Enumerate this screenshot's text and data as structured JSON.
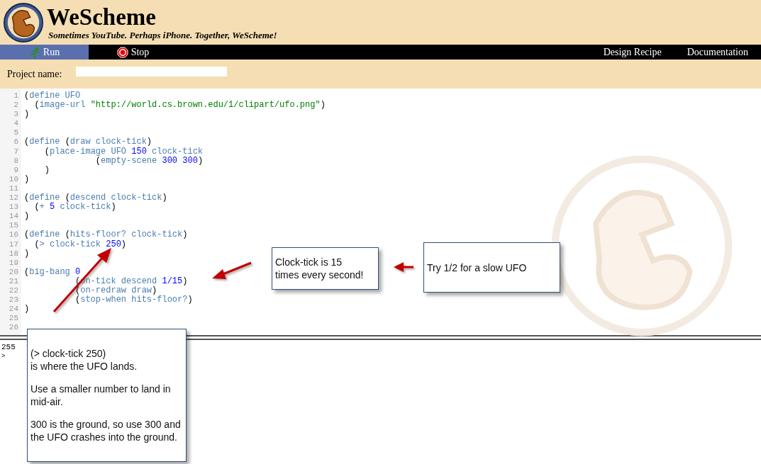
{
  "header": {
    "title": "WeScheme",
    "tagline": "Sometimes YouTube. Perhaps iPhone. Together, WeScheme!"
  },
  "toolbar": {
    "left": [
      {
        "label": "Run",
        "kind": "run",
        "selected": true
      },
      {
        "label": "Stop",
        "kind": "stop",
        "selected": false
      }
    ],
    "right": [
      "Design Recipe",
      "Documentation"
    ]
  },
  "project": {
    "label": "Project name:"
  },
  "editor": {
    "lines": [
      {
        "number": "1",
        "tokens": [
          {
            "kind": "paren",
            "text": "("
          },
          {
            "kind": "keyword",
            "text": "define UFO"
          }
        ]
      },
      {
        "number": "2",
        "tokens": [
          {
            "kind": "paren",
            "text": "  ("
          },
          {
            "kind": "keyword",
            "text": "image-url "
          },
          {
            "kind": "string",
            "text": "\"http://world.cs.brown.edu/1/clipart/ufo.png\""
          },
          {
            "kind": "paren",
            "text": ")"
          }
        ]
      },
      {
        "number": "3",
        "tokens": [
          {
            "kind": "paren",
            "text": ")"
          }
        ]
      },
      {
        "number": "4"
      },
      {
        "number": "5"
      },
      {
        "number": "6",
        "tokens": [
          {
            "kind": "paren",
            "text": "("
          },
          {
            "kind": "keyword",
            "text": "define "
          },
          {
            "kind": "paren",
            "text": "("
          },
          {
            "kind": "keyword",
            "text": "draw clock-tick"
          },
          {
            "kind": "paren",
            "text": ")"
          }
        ]
      },
      {
        "number": "7",
        "tokens": [
          {
            "kind": "paren",
            "text": "    ("
          },
          {
            "kind": "keyword",
            "text": "place-image UFO "
          },
          {
            "kind": "number",
            "text": "150"
          },
          {
            "kind": "keyword",
            "text": " clock-tick"
          }
        ]
      },
      {
        "number": "8",
        "tokens": [
          {
            "kind": "paren",
            "text": "              ("
          },
          {
            "kind": "keyword",
            "text": "empty-scene "
          },
          {
            "kind": "number",
            "text": "300 300"
          },
          {
            "kind": "paren",
            "text": ")"
          }
        ]
      },
      {
        "number": "9",
        "tokens": [
          {
            "kind": "paren",
            "text": "    )"
          }
        ]
      },
      {
        "number": "10",
        "tokens": [
          {
            "kind": "paren",
            "text": ")"
          }
        ]
      },
      {
        "number": "11"
      },
      {
        "number": "12",
        "tokens": [
          {
            "kind": "paren",
            "text": "("
          },
          {
            "kind": "keyword",
            "text": "define "
          },
          {
            "kind": "paren",
            "text": "("
          },
          {
            "kind": "keyword",
            "text": "descend clock-tick"
          },
          {
            "kind": "paren",
            "text": ")"
          }
        ]
      },
      {
        "number": "13",
        "tokens": [
          {
            "kind": "paren",
            "text": "  ("
          },
          {
            "kind": "keyword",
            "text": "+ "
          },
          {
            "kind": "number",
            "text": "5"
          },
          {
            "kind": "keyword",
            "text": " clock-tick"
          },
          {
            "kind": "paren",
            "text": ")"
          }
        ]
      },
      {
        "number": "14",
        "tokens": [
          {
            "kind": "paren",
            "text": ")"
          }
        ]
      },
      {
        "number": "15"
      },
      {
        "number": "16",
        "tokens": [
          {
            "kind": "paren",
            "text": "("
          },
          {
            "kind": "keyword",
            "text": "define "
          },
          {
            "kind": "paren",
            "text": "("
          },
          {
            "kind": "keyword",
            "text": "hits-floor? clock-tick"
          },
          {
            "kind": "paren",
            "text": ")"
          }
        ]
      },
      {
        "number": "17",
        "tokens": [
          {
            "kind": "paren",
            "text": "  ("
          },
          {
            "kind": "keyword",
            "text": "> clock-tick "
          },
          {
            "kind": "number",
            "text": "250"
          },
          {
            "kind": "paren",
            "text": ")"
          }
        ]
      },
      {
        "number": "18",
        "tokens": [
          {
            "kind": "paren",
            "text": ")"
          }
        ]
      },
      {
        "number": "19"
      },
      {
        "number": "20",
        "tokens": [
          {
            "kind": "paren",
            "text": "("
          },
          {
            "kind": "keyword",
            "text": "big-bang "
          },
          {
            "kind": "number",
            "text": "0"
          }
        ]
      },
      {
        "number": "21",
        "tokens": [
          {
            "kind": "paren",
            "text": "          ("
          },
          {
            "kind": "keyword",
            "text": "on-tick descend "
          },
          {
            "kind": "number",
            "text": "1/15"
          },
          {
            "kind": "paren",
            "text": ")"
          }
        ]
      },
      {
        "number": "22",
        "tokens": [
          {
            "kind": "paren",
            "text": "          ("
          },
          {
            "kind": "keyword",
            "text": "on-redraw draw"
          },
          {
            "kind": "paren",
            "text": ")"
          }
        ]
      },
      {
        "number": "23",
        "tokens": [
          {
            "kind": "paren",
            "text": "          ("
          },
          {
            "kind": "keyword",
            "text": "stop-when hits-floor?"
          },
          {
            "kind": "paren",
            "text": ")"
          }
        ]
      },
      {
        "number": "24",
        "tokens": [
          {
            "kind": "paren",
            "text": ")"
          }
        ]
      },
      {
        "number": "25"
      },
      {
        "number": "26"
      }
    ]
  },
  "repl": {
    "output": "255",
    "prompt": ">"
  },
  "callouts": [
    {
      "paragraphs": [
        "Clock-tick is 15\ntimes every second!"
      ]
    },
    {
      "paragraphs": [
        "Try 1/2 for a slow UFO"
      ]
    },
    {
      "paragraphs": [
        "(> clock-tick 250)\n    is where the UFO lands.",
        "Use a smaller number to land in mid-air.",
        "300 is the ground, so use 300 and the UFO crashes into the ground."
      ]
    }
  ]
}
